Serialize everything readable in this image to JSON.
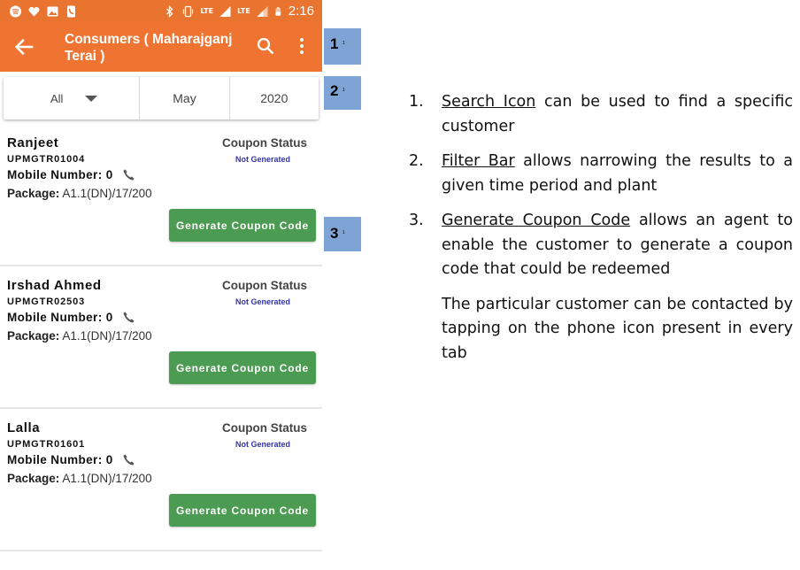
{
  "status_bar": {
    "time": "2:16",
    "network_label": "LTE",
    "network_label_2": "LTE",
    "left_icons": [
      "spotify-icon",
      "heart-icon",
      "image-icon",
      "phone-icon"
    ],
    "right_icons": [
      "bluetooth-icon",
      "vibrate-icon",
      "volte-call-icon",
      "signal-icon",
      "battery-icon"
    ]
  },
  "app_bar": {
    "title": "Consumers ( Maharajganj Terai )",
    "color": "#ef7431"
  },
  "filter": {
    "plant": "All",
    "month": "May",
    "year": "2020"
  },
  "consumers": [
    {
      "name": "Ranjeet",
      "id": "UPMGTR01004",
      "mobile_label": "Mobile Number:",
      "mobile_value": "0",
      "package_label": "Package:",
      "package_value": "A1.1(DN)/17/200",
      "coupon_label": "Coupon Status",
      "coupon_status": "Not Generated",
      "button_label": "Generate Coupon Code"
    },
    {
      "name": "Irshad Ahmed",
      "id": "UPMGTR02503",
      "mobile_label": "Mobile Number:",
      "mobile_value": "0",
      "package_label": "Package:",
      "package_value": "A1.1(DN)/17/200",
      "coupon_label": "Coupon Status",
      "coupon_status": "Not Generated",
      "button_label": "Generate Coupon Code"
    },
    {
      "name": "Lalla",
      "id": "UPMGTR01601",
      "mobile_label": "Mobile Number:",
      "mobile_value": "0",
      "package_label": "Package:",
      "package_value": "A1.1(DN)/17/200",
      "coupon_label": "Coupon Status",
      "coupon_status": "Not Generated",
      "button_label": "Generate Coupon Code"
    }
  ],
  "markers": [
    {
      "num": "1",
      "sub": "1"
    },
    {
      "num": "2",
      "sub": "1"
    },
    {
      "num": "3",
      "sub": "1"
    }
  ],
  "notes": [
    {
      "num": "1.",
      "keyword": "Search Icon",
      "text": " can be used to find a specific customer"
    },
    {
      "num": "2.",
      "keyword": "Filter Bar",
      "text": " allows narrowing the results to a given time period and plant"
    },
    {
      "num": "3.",
      "keyword": "Generate Coupon Code",
      "text": " allows an agent to enable the customer to generate a coupon code that could be redeemed"
    }
  ],
  "note_extra": "The particular customer can be contacted by tapping on the phone icon present in every tab",
  "colors": {
    "accent": "#ef7431",
    "button": "#4b9b52",
    "marker": "#7ea4d6",
    "status_text": "#3333aa"
  }
}
